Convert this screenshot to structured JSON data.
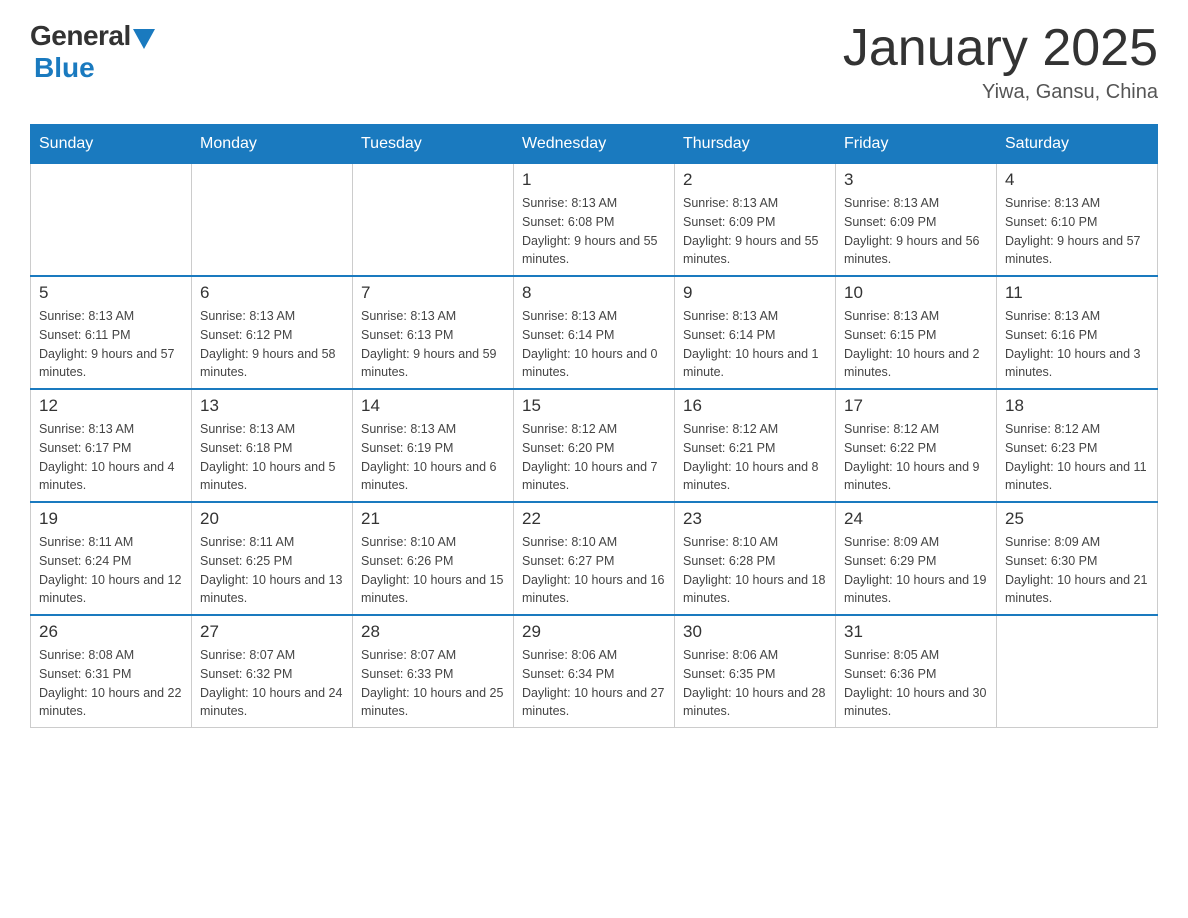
{
  "header": {
    "logo_general": "General",
    "logo_blue": "Blue",
    "title": "January 2025",
    "location": "Yiwa, Gansu, China"
  },
  "days_of_week": [
    "Sunday",
    "Monday",
    "Tuesday",
    "Wednesday",
    "Thursday",
    "Friday",
    "Saturday"
  ],
  "weeks": [
    [
      {
        "day": "",
        "sunrise": "",
        "sunset": "",
        "daylight": "",
        "empty": true
      },
      {
        "day": "",
        "sunrise": "",
        "sunset": "",
        "daylight": "",
        "empty": true
      },
      {
        "day": "",
        "sunrise": "",
        "sunset": "",
        "daylight": "",
        "empty": true
      },
      {
        "day": "1",
        "sunrise": "Sunrise: 8:13 AM",
        "sunset": "Sunset: 6:08 PM",
        "daylight": "Daylight: 9 hours and 55 minutes."
      },
      {
        "day": "2",
        "sunrise": "Sunrise: 8:13 AM",
        "sunset": "Sunset: 6:09 PM",
        "daylight": "Daylight: 9 hours and 55 minutes."
      },
      {
        "day": "3",
        "sunrise": "Sunrise: 8:13 AM",
        "sunset": "Sunset: 6:09 PM",
        "daylight": "Daylight: 9 hours and 56 minutes."
      },
      {
        "day": "4",
        "sunrise": "Sunrise: 8:13 AM",
        "sunset": "Sunset: 6:10 PM",
        "daylight": "Daylight: 9 hours and 57 minutes."
      }
    ],
    [
      {
        "day": "5",
        "sunrise": "Sunrise: 8:13 AM",
        "sunset": "Sunset: 6:11 PM",
        "daylight": "Daylight: 9 hours and 57 minutes."
      },
      {
        "day": "6",
        "sunrise": "Sunrise: 8:13 AM",
        "sunset": "Sunset: 6:12 PM",
        "daylight": "Daylight: 9 hours and 58 minutes."
      },
      {
        "day": "7",
        "sunrise": "Sunrise: 8:13 AM",
        "sunset": "Sunset: 6:13 PM",
        "daylight": "Daylight: 9 hours and 59 minutes."
      },
      {
        "day": "8",
        "sunrise": "Sunrise: 8:13 AM",
        "sunset": "Sunset: 6:14 PM",
        "daylight": "Daylight: 10 hours and 0 minutes."
      },
      {
        "day": "9",
        "sunrise": "Sunrise: 8:13 AM",
        "sunset": "Sunset: 6:14 PM",
        "daylight": "Daylight: 10 hours and 1 minute."
      },
      {
        "day": "10",
        "sunrise": "Sunrise: 8:13 AM",
        "sunset": "Sunset: 6:15 PM",
        "daylight": "Daylight: 10 hours and 2 minutes."
      },
      {
        "day": "11",
        "sunrise": "Sunrise: 8:13 AM",
        "sunset": "Sunset: 6:16 PM",
        "daylight": "Daylight: 10 hours and 3 minutes."
      }
    ],
    [
      {
        "day": "12",
        "sunrise": "Sunrise: 8:13 AM",
        "sunset": "Sunset: 6:17 PM",
        "daylight": "Daylight: 10 hours and 4 minutes."
      },
      {
        "day": "13",
        "sunrise": "Sunrise: 8:13 AM",
        "sunset": "Sunset: 6:18 PM",
        "daylight": "Daylight: 10 hours and 5 minutes."
      },
      {
        "day": "14",
        "sunrise": "Sunrise: 8:13 AM",
        "sunset": "Sunset: 6:19 PM",
        "daylight": "Daylight: 10 hours and 6 minutes."
      },
      {
        "day": "15",
        "sunrise": "Sunrise: 8:12 AM",
        "sunset": "Sunset: 6:20 PM",
        "daylight": "Daylight: 10 hours and 7 minutes."
      },
      {
        "day": "16",
        "sunrise": "Sunrise: 8:12 AM",
        "sunset": "Sunset: 6:21 PM",
        "daylight": "Daylight: 10 hours and 8 minutes."
      },
      {
        "day": "17",
        "sunrise": "Sunrise: 8:12 AM",
        "sunset": "Sunset: 6:22 PM",
        "daylight": "Daylight: 10 hours and 9 minutes."
      },
      {
        "day": "18",
        "sunrise": "Sunrise: 8:12 AM",
        "sunset": "Sunset: 6:23 PM",
        "daylight": "Daylight: 10 hours and 11 minutes."
      }
    ],
    [
      {
        "day": "19",
        "sunrise": "Sunrise: 8:11 AM",
        "sunset": "Sunset: 6:24 PM",
        "daylight": "Daylight: 10 hours and 12 minutes."
      },
      {
        "day": "20",
        "sunrise": "Sunrise: 8:11 AM",
        "sunset": "Sunset: 6:25 PM",
        "daylight": "Daylight: 10 hours and 13 minutes."
      },
      {
        "day": "21",
        "sunrise": "Sunrise: 8:10 AM",
        "sunset": "Sunset: 6:26 PM",
        "daylight": "Daylight: 10 hours and 15 minutes."
      },
      {
        "day": "22",
        "sunrise": "Sunrise: 8:10 AM",
        "sunset": "Sunset: 6:27 PM",
        "daylight": "Daylight: 10 hours and 16 minutes."
      },
      {
        "day": "23",
        "sunrise": "Sunrise: 8:10 AM",
        "sunset": "Sunset: 6:28 PM",
        "daylight": "Daylight: 10 hours and 18 minutes."
      },
      {
        "day": "24",
        "sunrise": "Sunrise: 8:09 AM",
        "sunset": "Sunset: 6:29 PM",
        "daylight": "Daylight: 10 hours and 19 minutes."
      },
      {
        "day": "25",
        "sunrise": "Sunrise: 8:09 AM",
        "sunset": "Sunset: 6:30 PM",
        "daylight": "Daylight: 10 hours and 21 minutes."
      }
    ],
    [
      {
        "day": "26",
        "sunrise": "Sunrise: 8:08 AM",
        "sunset": "Sunset: 6:31 PM",
        "daylight": "Daylight: 10 hours and 22 minutes."
      },
      {
        "day": "27",
        "sunrise": "Sunrise: 8:07 AM",
        "sunset": "Sunset: 6:32 PM",
        "daylight": "Daylight: 10 hours and 24 minutes."
      },
      {
        "day": "28",
        "sunrise": "Sunrise: 8:07 AM",
        "sunset": "Sunset: 6:33 PM",
        "daylight": "Daylight: 10 hours and 25 minutes."
      },
      {
        "day": "29",
        "sunrise": "Sunrise: 8:06 AM",
        "sunset": "Sunset: 6:34 PM",
        "daylight": "Daylight: 10 hours and 27 minutes."
      },
      {
        "day": "30",
        "sunrise": "Sunrise: 8:06 AM",
        "sunset": "Sunset: 6:35 PM",
        "daylight": "Daylight: 10 hours and 28 minutes."
      },
      {
        "day": "31",
        "sunrise": "Sunrise: 8:05 AM",
        "sunset": "Sunset: 6:36 PM",
        "daylight": "Daylight: 10 hours and 30 minutes."
      },
      {
        "day": "",
        "sunrise": "",
        "sunset": "",
        "daylight": "",
        "empty": true
      }
    ]
  ]
}
